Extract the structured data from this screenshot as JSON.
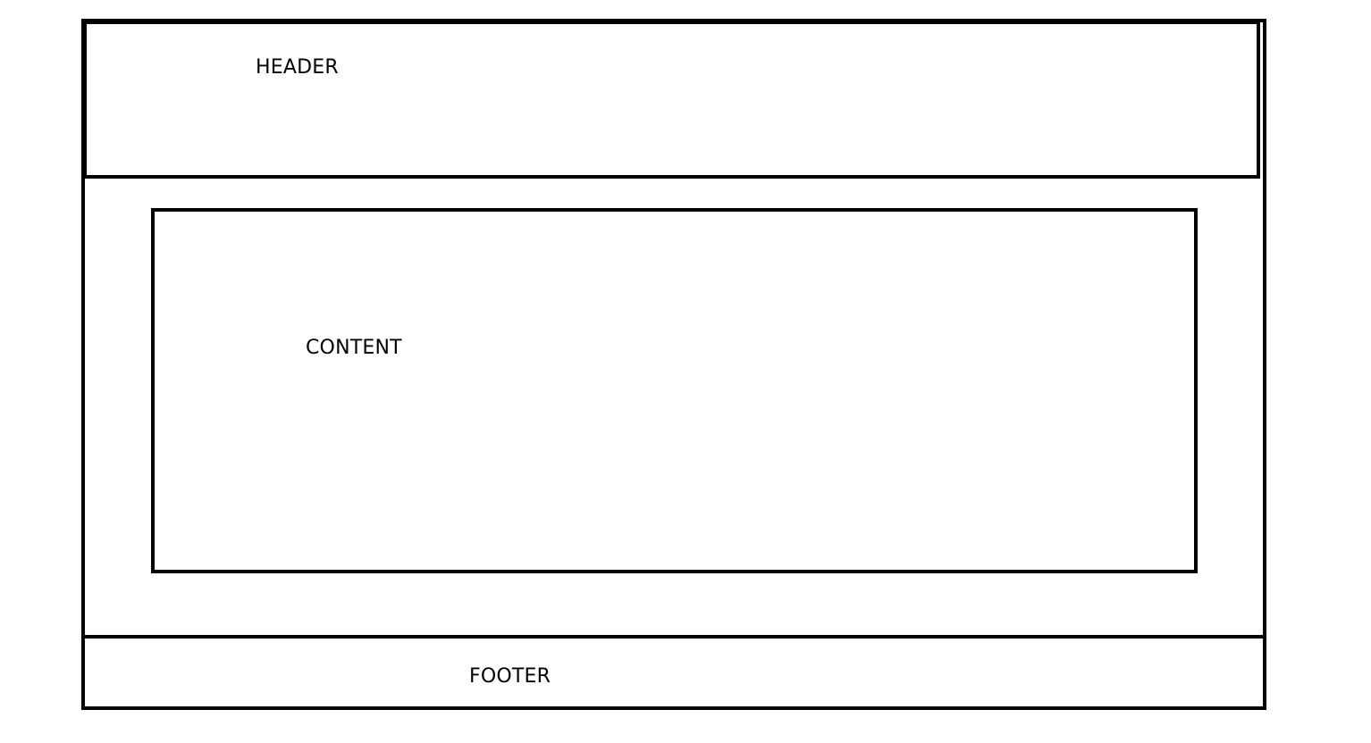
{
  "layout_diagram": {
    "header": {
      "label": "HEADER"
    },
    "content": {
      "label": "CONTENT"
    },
    "footer": {
      "label": "FOOTER"
    }
  }
}
